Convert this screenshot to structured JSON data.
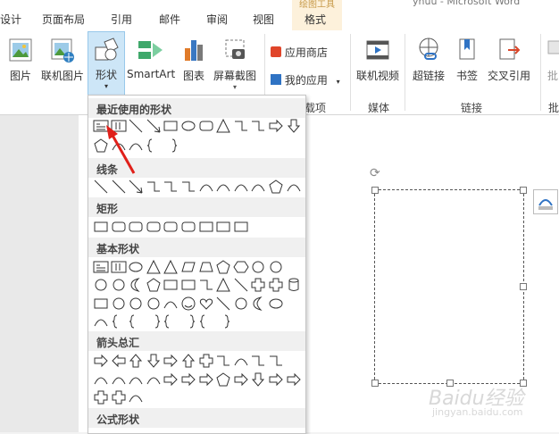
{
  "tabs": {
    "design": "设计",
    "layout": "页面布局",
    "references": "引用",
    "mailings": "邮件",
    "review": "审阅",
    "view": "视图",
    "format_context": "绘图工具",
    "format": "格式"
  },
  "top_right": "yhuu - Microsoft Word",
  "ribbon": {
    "picture": "图片",
    "online_picture": "联机图片",
    "shapes": "形状",
    "smartart": "SmartArt",
    "chart": "图表",
    "screenshot": "屏幕截图",
    "app_store": "应用商店",
    "my_apps": "我的应用",
    "online_video": "联机视频",
    "hyperlink": "超链接",
    "bookmark": "书签",
    "cross_ref": "交叉引用",
    "comment_partial": "批",
    "group_apps_partial": "载项",
    "group_media": "媒体",
    "group_links": "链接",
    "group_comments_partial": "批"
  },
  "dropdown": {
    "recent": "最近使用的形状",
    "lines": "线条",
    "rectangles": "矩形",
    "basic": "基本形状",
    "arrows": "箭头总汇",
    "equation": "公式形状"
  },
  "watermark": "Baidu经验",
  "watermark_sub": "jingyan.baidu.com",
  "colors": {
    "accent_blue": "#cde6f7",
    "format_tab": "#fdf1db",
    "arrow_red": "#e0201a"
  }
}
